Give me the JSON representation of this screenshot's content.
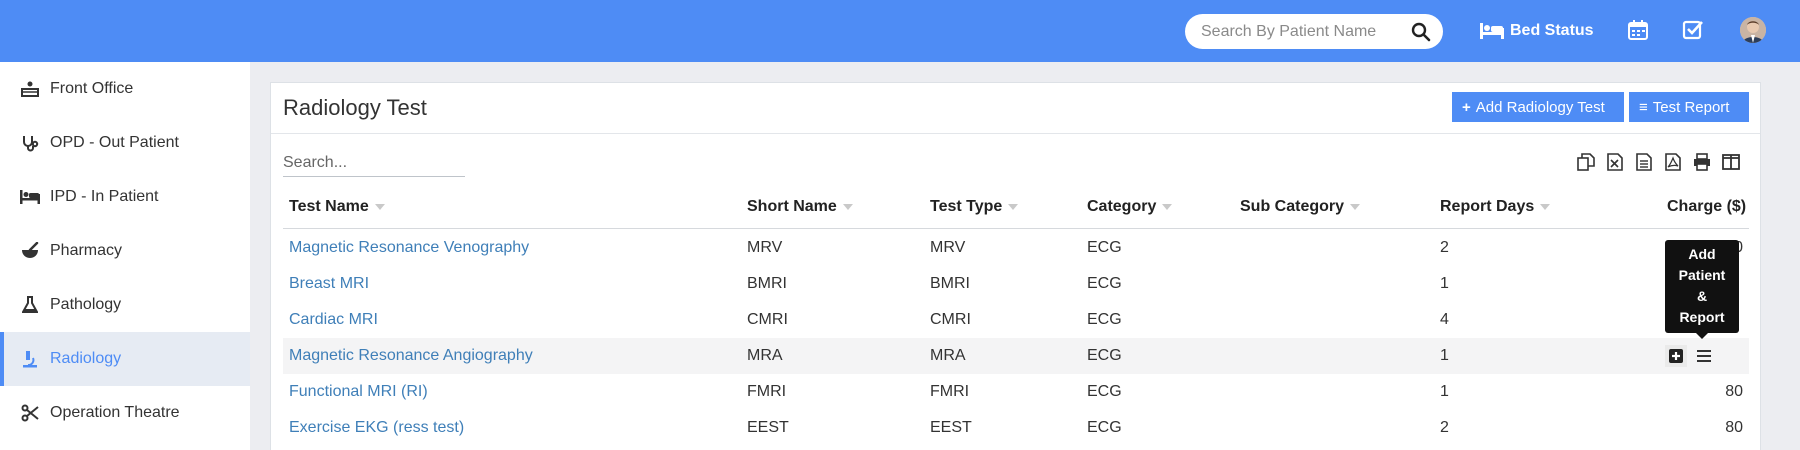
{
  "header": {
    "search": {
      "placeholder": "Search By Patient Name",
      "value": ""
    },
    "bed_status_label": "Bed Status",
    "icons": [
      "search-icon",
      "bed-icon",
      "calendar-icon",
      "checkbox-icon",
      "avatar"
    ],
    "background_color": "#4e8cf5"
  },
  "sidebar": {
    "active_color": "#4e8cf5",
    "items": [
      {
        "label": "Front Office",
        "icon": "reception-icon",
        "active": false
      },
      {
        "label": "OPD - Out Patient",
        "icon": "stethoscope-icon",
        "active": false
      },
      {
        "label": "IPD - In Patient",
        "icon": "bed-icon",
        "active": false
      },
      {
        "label": "Pharmacy",
        "icon": "mortar-pestle-icon",
        "active": false
      },
      {
        "label": "Pathology",
        "icon": "flask-icon",
        "active": false
      },
      {
        "label": "Radiology",
        "icon": "microscope-icon",
        "active": true
      },
      {
        "label": "Operation Theatre",
        "icon": "scissors-icon",
        "active": false
      }
    ]
  },
  "panel": {
    "title": "Radiology Test",
    "add_button": {
      "icon": "+",
      "label": "Add Radiology Test"
    },
    "report_button": {
      "icon": "≡",
      "label": "Test Report"
    },
    "search_placeholder": "Search...",
    "tools": [
      "copy-icon",
      "excel-icon",
      "csv-icon",
      "pdf-icon",
      "print-icon",
      "columns-icon"
    ]
  },
  "table": {
    "headers": [
      "Test Name",
      "Short Name",
      "Test Type",
      "Category",
      "Sub Category",
      "Report Days",
      "Charge ($)"
    ],
    "rows": [
      {
        "test_name": "Magnetic Resonance Venography",
        "short_name": "MRV",
        "test_type": "MRV",
        "category": "ECG",
        "sub_category": "",
        "report_days": "2",
        "charge": "100"
      },
      {
        "test_name": "Breast MRI",
        "short_name": "BMRI",
        "test_type": "BMRI",
        "category": "ECG",
        "sub_category": "",
        "report_days": "1",
        "charge": ""
      },
      {
        "test_name": "Cardiac MRI",
        "short_name": "CMRI",
        "test_type": "CMRI",
        "category": "ECG",
        "sub_category": "",
        "report_days": "4",
        "charge": ""
      },
      {
        "test_name": "Magnetic Resonance Angiography",
        "short_name": "MRA",
        "test_type": "MRA",
        "category": "ECG",
        "sub_category": "",
        "report_days": "1",
        "charge": ""
      },
      {
        "test_name": "Functional MRI (RI)",
        "short_name": "FMRI",
        "test_type": "FMRI",
        "category": "ECG",
        "sub_category": "",
        "report_days": "1",
        "charge": "80"
      },
      {
        "test_name": "Exercise EKG (ress test)",
        "short_name": "EEST",
        "test_type": "EEST",
        "category": "ECG",
        "sub_category": "",
        "report_days": "2",
        "charge": "80"
      }
    ],
    "hovered_row_actions": [
      "add-patient-report-icon",
      "menu-icon"
    ]
  },
  "tooltip": {
    "lines": [
      "Add",
      "Patient",
      "&",
      "Report"
    ]
  }
}
